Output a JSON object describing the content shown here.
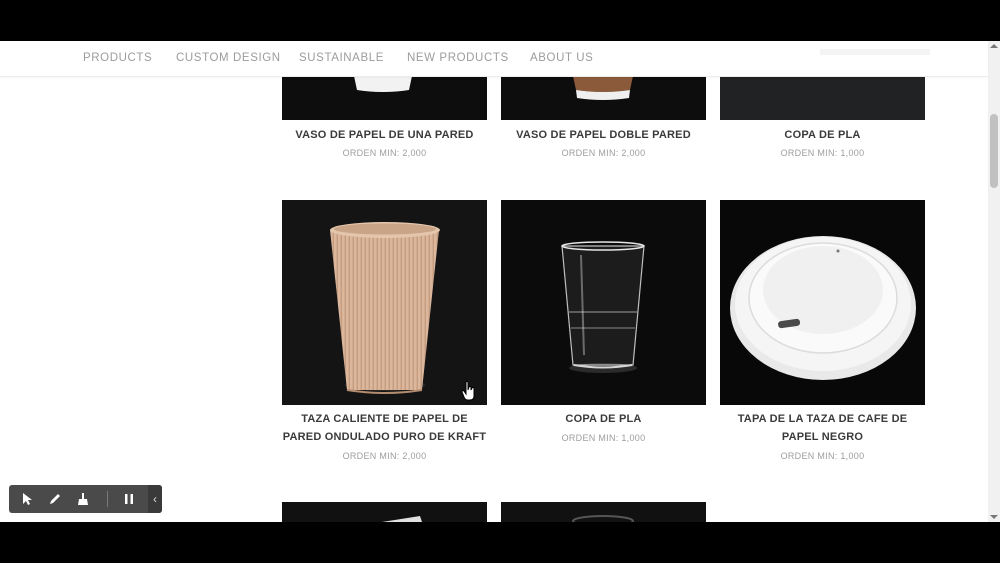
{
  "nav": {
    "items": [
      "PRODUCTS",
      "CUSTOM DESIGN",
      "SUSTAINABLE",
      "NEW PRODUCTS",
      "ABOUT US"
    ]
  },
  "products": [
    {
      "name": "VASO DE PAPEL DE UNA PARED",
      "moq": "ORDEN MIN: 2,000"
    },
    {
      "name": "VASO DE PAPEL DOBLE PARED",
      "moq": "ORDEN MIN: 2,000"
    },
    {
      "name": "COPA DE PLA",
      "moq": "ORDEN MIN: 1,000"
    },
    {
      "name": "TAZA CALIENTE DE PAPEL DE PARED ONDULADO PURO DE KRAFT",
      "moq": "ORDEN MIN: 2,000"
    },
    {
      "name": "COPA DE PLA",
      "moq": "ORDEN MIN: 1,000"
    },
    {
      "name": "TAPA DE LA TAZA DE CAFE DE PAPEL NEGRO",
      "moq": "ORDEN MIN: 1,000"
    }
  ],
  "toolbar": {
    "icons": [
      "pointer-icon",
      "pencil-icon",
      "broom-icon",
      "pause-icon",
      "chevron-left-icon"
    ],
    "collapse_glyph": "‹"
  },
  "colors": {
    "nav_text": "#9c9c9c",
    "product_name": "#3a3a3a",
    "moq_text": "#9d9d9d",
    "image_bg": "#0d0d0d",
    "kraft": "#d9b59a"
  }
}
